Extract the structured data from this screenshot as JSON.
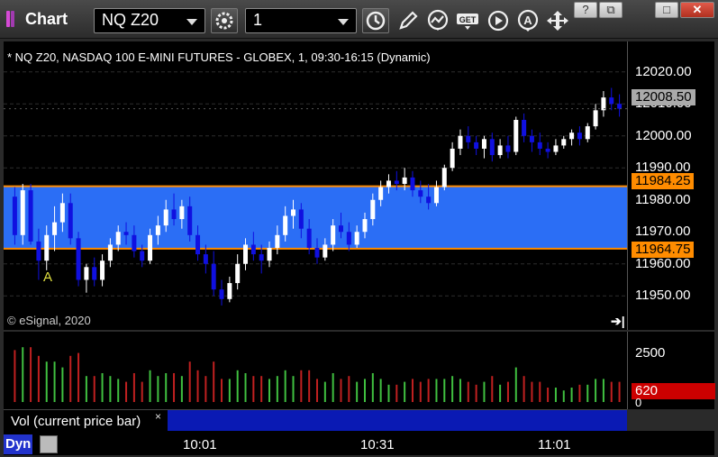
{
  "app": {
    "title": "Chart"
  },
  "toolbar": {
    "symbol": "NQ Z20",
    "interval": "1",
    "buttons": [
      "settings-icon",
      "clock-icon",
      "pencil-icon",
      "analysis-icon",
      "get-icon",
      "play-icon",
      "alert-icon",
      "arrows-icon"
    ],
    "window_controls": {
      "help": "?",
      "restore": "⧉",
      "maximize": "□",
      "close": "✕"
    }
  },
  "chart": {
    "info": "* NQ Z20, NASDAQ 100 E-MINI FUTURES - GLOBEX, 1, 09:30-16:15 (Dynamic)",
    "copyright": "© eSignal, 2020",
    "marker": "A",
    "colors": {
      "up": "#ffffff",
      "down": "#1010e0",
      "zone": "#2b6ef5",
      "zone_line": "#ff8c00",
      "grid": "#2d2d2d"
    }
  },
  "price_axis": {
    "ticks": [
      "12020.00",
      "12010.00",
      "12000.00",
      "11990.00",
      "11980.00",
      "11970.00",
      "11960.00",
      "11950.00"
    ],
    "last_price": "12008.50",
    "zone_high": "11984.25",
    "zone_low": "11964.75"
  },
  "volume": {
    "axis_label": "2500",
    "zero_label": "0",
    "last_volume": "620",
    "study_label": "Vol (current price bar)",
    "study_close": "×"
  },
  "time_axis": {
    "labels": [
      "10:01",
      "10:31",
      "11:01"
    ]
  },
  "status": {
    "dyn_label": "Dyn"
  },
  "chart_data": {
    "type": "candlestick",
    "ylim": [
      11945,
      12025
    ],
    "zone": [
      11964.75,
      11984.25
    ],
    "last": 12008.5,
    "bars": [
      [
        11981,
        11984,
        11966,
        11969
      ],
      [
        11969,
        11985,
        11966,
        11983
      ],
      [
        11983,
        11985,
        11966,
        11967
      ],
      [
        11967,
        11971,
        11955,
        11961
      ],
      [
        11961,
        11972,
        11958,
        11969
      ],
      [
        11969,
        11978,
        11964,
        11973
      ],
      [
        11973,
        11982,
        11970,
        11979
      ],
      [
        11979,
        11982,
        11966,
        11968
      ],
      [
        11968,
        11970,
        11953,
        11955
      ],
      [
        11955,
        11960,
        11951,
        11959
      ],
      [
        11959,
        11962,
        11953,
        11955
      ],
      [
        11955,
        11963,
        11953,
        11961
      ],
      [
        11961,
        11968,
        11959,
        11966
      ],
      [
        11966,
        11972,
        11964,
        11970
      ],
      [
        11970,
        11973,
        11966,
        11969
      ],
      [
        11969,
        11972,
        11962,
        11964
      ],
      [
        11964,
        11966,
        11959,
        11961
      ],
      [
        11961,
        11971,
        11960,
        11969
      ],
      [
        11969,
        11975,
        11966,
        11972
      ],
      [
        11972,
        11980,
        11970,
        11977
      ],
      [
        11977,
        11982,
        11972,
        11974
      ],
      [
        11974,
        11980,
        11971,
        11978
      ],
      [
        11978,
        11981,
        11967,
        11969
      ],
      [
        11969,
        11972,
        11961,
        11963
      ],
      [
        11963,
        11966,
        11957,
        11960
      ],
      [
        11960,
        11964,
        11950,
        11952
      ],
      [
        11952,
        11955,
        11947,
        11949
      ],
      [
        11949,
        11956,
        11948,
        11954
      ],
      [
        11954,
        11963,
        11952,
        11960
      ],
      [
        11960,
        11968,
        11958,
        11966
      ],
      [
        11966,
        11970,
        11961,
        11963
      ],
      [
        11963,
        11966,
        11957,
        11961
      ],
      [
        11961,
        11967,
        11959,
        11965
      ],
      [
        11965,
        11972,
        11963,
        11969
      ],
      [
        11969,
        11978,
        11967,
        11975
      ],
      [
        11975,
        11980,
        11971,
        11977
      ],
      [
        11977,
        11979,
        11968,
        11971
      ],
      [
        11971,
        11974,
        11963,
        11965
      ],
      [
        11965,
        11968,
        11960,
        11962
      ],
      [
        11962,
        11968,
        11961,
        11966
      ],
      [
        11966,
        11974,
        11964,
        11972
      ],
      [
        11972,
        11976,
        11968,
        11970
      ],
      [
        11970,
        11973,
        11964,
        11966
      ],
      [
        11966,
        11972,
        11965,
        11970
      ],
      [
        11970,
        11976,
        11968,
        11974
      ],
      [
        11974,
        11982,
        11972,
        11980
      ],
      [
        11980,
        11986,
        11978,
        11984
      ],
      [
        11984,
        11988,
        11982,
        11986
      ],
      [
        11986,
        11989,
        11983,
        11985
      ],
      [
        11985,
        11990,
        11983,
        11987
      ],
      [
        11987,
        11989,
        11981,
        11983
      ],
      [
        11983,
        11986,
        11979,
        11981
      ],
      [
        11981,
        11985,
        11977,
        11979
      ],
      [
        11979,
        11986,
        11978,
        11984
      ],
      [
        11984,
        11991,
        11983,
        11990
      ],
      [
        11990,
        11998,
        11989,
        11996
      ],
      [
        11996,
        12002,
        11994,
        12000
      ],
      [
        12000,
        12003,
        11996,
        11998
      ],
      [
        11998,
        12000,
        11994,
        11996
      ],
      [
        11996,
        12000,
        11993,
        11999
      ],
      [
        11999,
        12001,
        11992,
        11994
      ],
      [
        11994,
        11999,
        11993,
        11997
      ],
      [
        11997,
        12000,
        11993,
        11995
      ],
      [
        11995,
        12006,
        11994,
        12005
      ],
      [
        12005,
        12007,
        11998,
        12000
      ],
      [
        12000,
        12002,
        11995,
        11998
      ],
      [
        11998,
        12001,
        11994,
        11996
      ],
      [
        11996,
        11998,
        11993,
        11995
      ],
      [
        11995,
        11999,
        11994,
        11997
      ],
      [
        11997,
        12000,
        11996,
        11999
      ],
      [
        11999,
        12002,
        11997,
        12001
      ],
      [
        12001,
        12003,
        11997,
        11999
      ],
      [
        11999,
        12004,
        11998,
        12003
      ],
      [
        12003,
        12010,
        12002,
        12008
      ],
      [
        12008,
        12014,
        12006,
        12012
      ],
      [
        12012,
        12015,
        12008,
        12010
      ],
      [
        12010,
        12013,
        12006,
        12008.5
      ]
    ]
  }
}
